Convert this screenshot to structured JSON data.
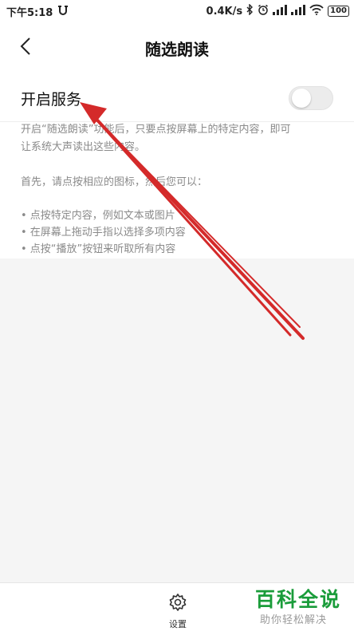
{
  "status_bar": {
    "time": "下午5:18",
    "network_speed": "0.4K/s",
    "battery": "100",
    "icons": [
      "notification-icon",
      "bluetooth-icon",
      "alarm-icon",
      "signal-icon",
      "signal-icon",
      "wifi-icon",
      "battery-icon"
    ]
  },
  "header": {
    "title": "随选朗读",
    "back_icon": "chevron-left-icon"
  },
  "service": {
    "label": "开启服务",
    "toggle_on": false
  },
  "description": {
    "line1": "开启“随选朗读”功能后，只要点按屏幕上的特定内容，即可",
    "line2": "让系统大声读出这些内容。",
    "line3": "首先，请点按相应的图标，然后您可以：",
    "bullets": [
      "• 点按特定内容，例如文本或图片",
      "• 在屏幕上拖动手指以选择多项内容",
      "• 点按“播放”按钮来听取所有内容"
    ]
  },
  "bottom_bar": {
    "settings_label": "设置",
    "settings_icon": "gear-icon"
  },
  "watermark": {
    "logo": "百科全说",
    "tagline": "助你轻松解决"
  },
  "colors": {
    "annotation_arrow": "#d42a2a",
    "watermark_green": "#1a9c3a"
  }
}
